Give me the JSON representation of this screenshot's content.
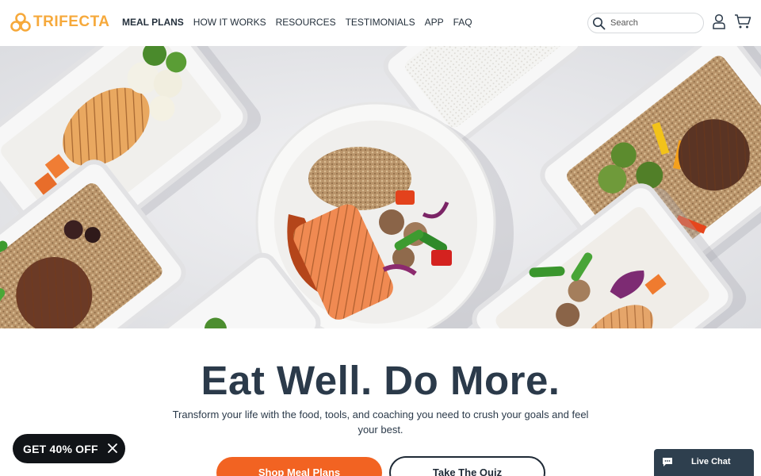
{
  "brand": {
    "name": "TRIFECTA",
    "color": "#f6a93b"
  },
  "nav": {
    "links": [
      {
        "label": "MEAL PLANS",
        "active": true
      },
      {
        "label": "HOW IT WORKS",
        "active": false
      },
      {
        "label": "RESOURCES",
        "active": false
      },
      {
        "label": "TESTIMONIALS",
        "active": false
      },
      {
        "label": "APP",
        "active": false
      },
      {
        "label": "FAQ",
        "active": false
      }
    ],
    "search_placeholder": "Search",
    "icons": [
      "search-icon",
      "account-icon",
      "cart-icon"
    ]
  },
  "hero": {
    "image": "meal-prep-containers-and-salmon-plate"
  },
  "main": {
    "headline": "Eat Well. Do More.",
    "subtext": "Transform your life with the food, tools, and coaching you need to crush your goals and feel your best.",
    "primary_cta": "Shop Meal Plans",
    "secondary_cta": "Take The Quiz"
  },
  "promo": {
    "label": "GET 40% OFF"
  },
  "chat": {
    "label": "Live Chat"
  },
  "colors": {
    "accent_orange": "#f26322",
    "text_dark": "#2b3a4a",
    "promo_bg": "#111418",
    "chat_bg": "#2e3f4e"
  }
}
